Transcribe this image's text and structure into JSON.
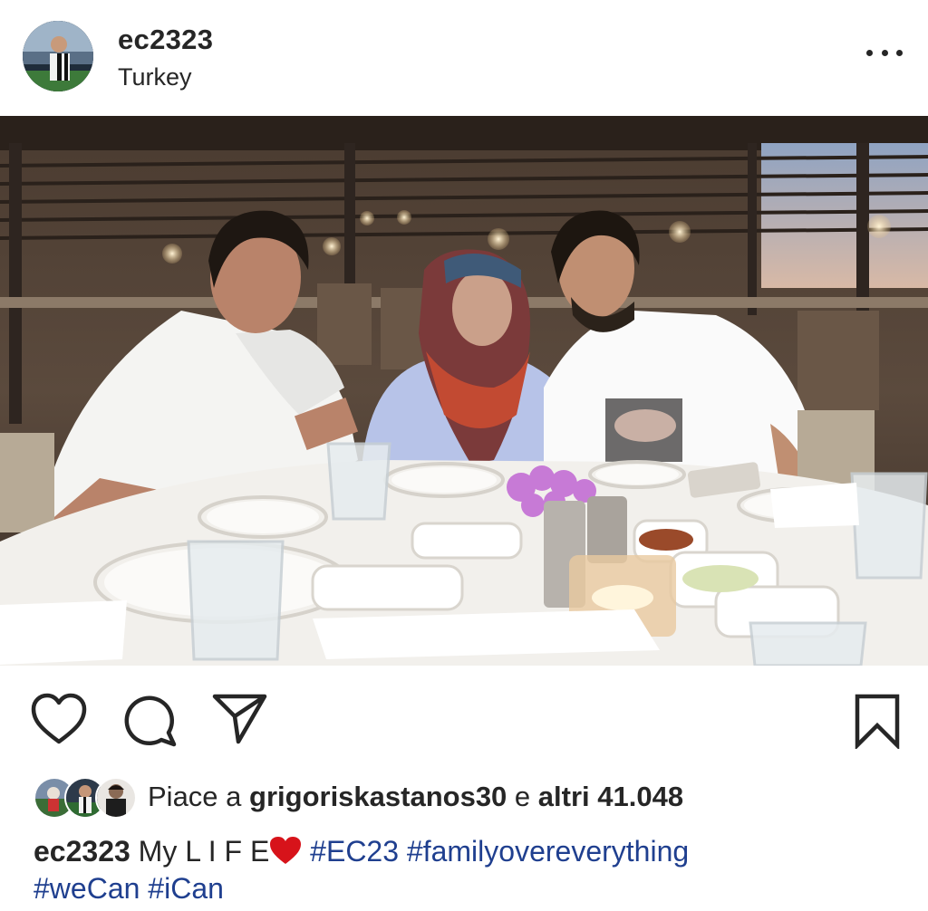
{
  "post": {
    "username": "ec2323",
    "location": "Turkey",
    "likes": {
      "prefix": "Piace a ",
      "first_liker": "grigoriskastanos30",
      "middle": " e ",
      "others": "altri 41.048"
    },
    "caption": {
      "username": "ec2323",
      "text": " My L I F E",
      "emoji": "❤️",
      "hashtags_line1": [
        "#EC23",
        "#familyovereverything"
      ],
      "hashtags_line2": [
        "#weCan",
        "#iCan"
      ]
    }
  },
  "icons": {
    "more": "more-options-icon",
    "like": "heart-icon",
    "comment": "comment-icon",
    "share": "paper-plane-icon",
    "save": "bookmark-icon"
  },
  "colors": {
    "text": "#262626",
    "hashtag": "#1f3f8f",
    "heart_emoji": "#d7131a"
  }
}
